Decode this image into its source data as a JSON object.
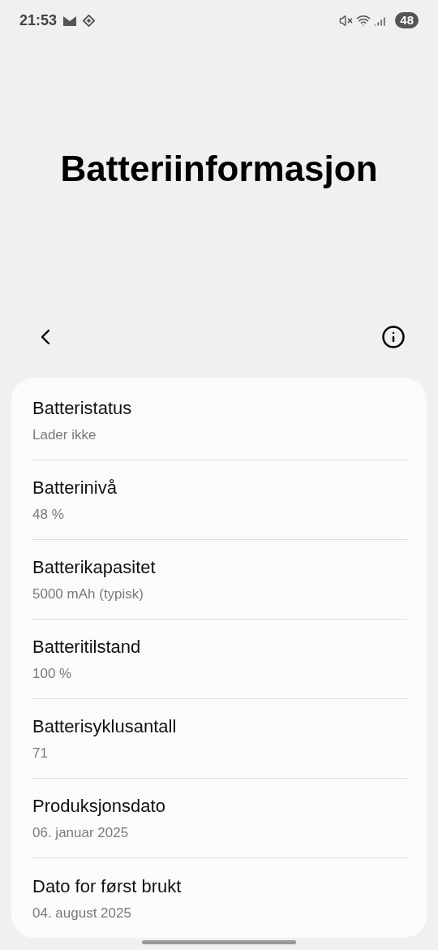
{
  "status_bar": {
    "time": "21:53",
    "battery": "48"
  },
  "title": "Batteriinformasjon",
  "items": [
    {
      "label": "Batteristatus",
      "value": "Lader ikke"
    },
    {
      "label": "Batterinivå",
      "value": "48 %"
    },
    {
      "label": "Batterikapasitet",
      "value": "5000 mAh (typisk)"
    },
    {
      "label": "Batteritilstand",
      "value": "100 %"
    },
    {
      "label": "Batterisyklusantall",
      "value": "71"
    },
    {
      "label": "Produksjonsdato",
      "value": "06. januar 2025"
    },
    {
      "label": "Dato for først brukt",
      "value": "04. august 2025"
    }
  ]
}
